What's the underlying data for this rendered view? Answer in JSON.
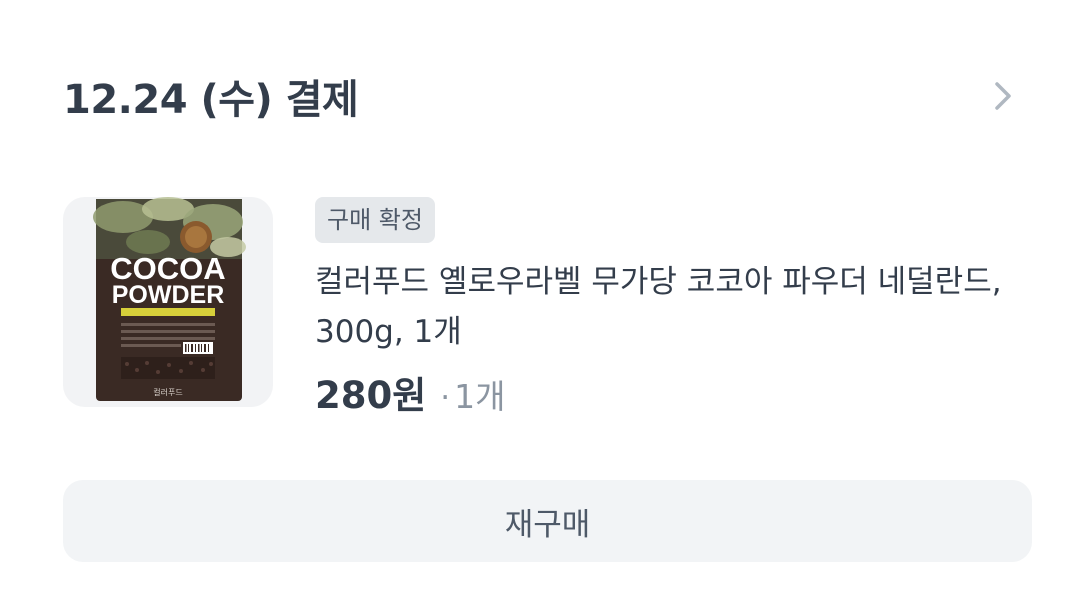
{
  "order": {
    "date_label": "12.24 (수) 결제"
  },
  "product": {
    "status_badge": "구매 확정",
    "name": "컬러푸드 옐로우라벨 무가당 코코아 파우더 네덜란드, 300g, 1개",
    "price": "280원",
    "separator": "·",
    "quantity": "1개",
    "image_text": {
      "line1": "COCOA",
      "line2": "POWDER",
      "brand": "컬러푸드"
    }
  },
  "actions": {
    "rebuy_label": "재구매"
  },
  "icons": {
    "detail": "chevron-right-icon"
  },
  "colors": {
    "text_primary": "#333d4b",
    "text_secondary": "#8b95a1",
    "badge_bg": "#e5e8eb",
    "button_bg": "#f2f4f6",
    "thumb_bg": "#f2f3f5"
  }
}
